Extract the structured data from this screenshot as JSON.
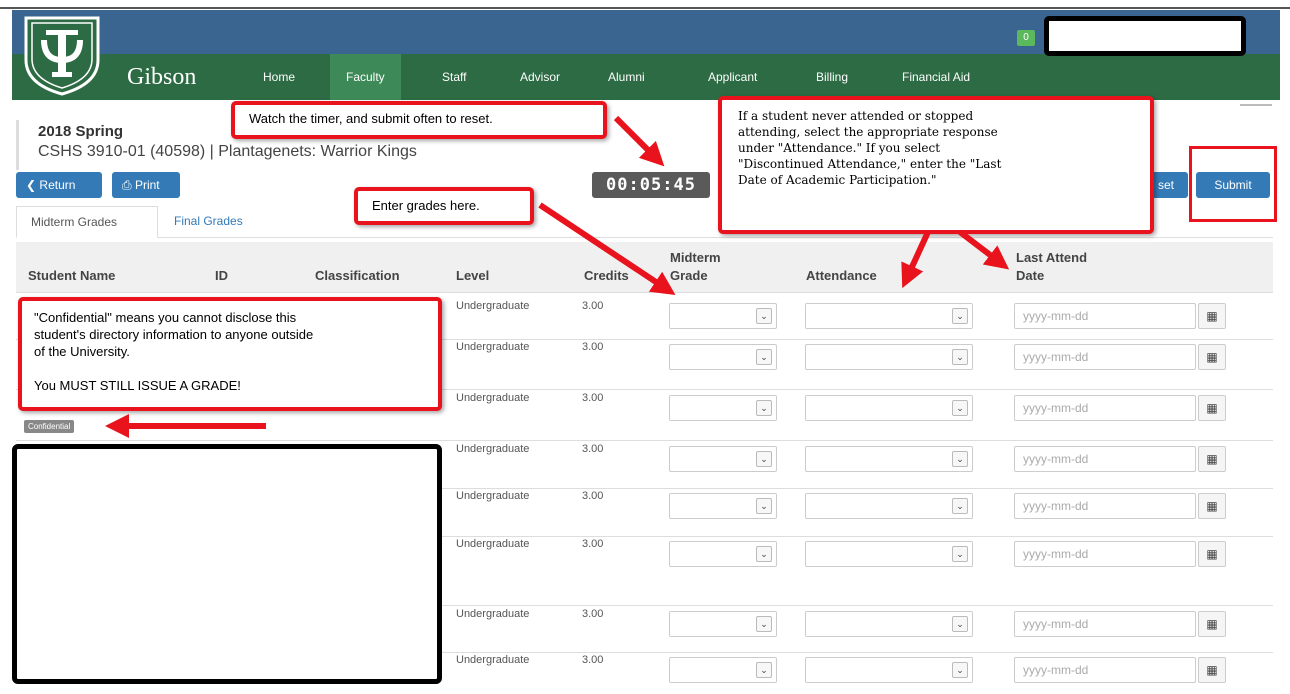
{
  "app": {
    "brand": "Gibson",
    "notification_count": "0"
  },
  "nav": [
    "Home",
    "Faculty",
    "Staff",
    "Advisor",
    "Alumni",
    "Applicant",
    "Billing",
    "Financial Aid"
  ],
  "header": {
    "term": "2018 Spring",
    "course": "CSHS 3910-01 (40598) | Plantagenets: Warrior Kings",
    "timer": "00:05:45"
  },
  "buttons": {
    "return": "Return",
    "print": "Print",
    "reset": "set",
    "submit": "Submit"
  },
  "tabs": [
    "Midterm Grades",
    "Final Grades"
  ],
  "table": {
    "headers": {
      "student_name": "Student Name",
      "id": "ID",
      "classification": "Classification",
      "level": "Level",
      "credits": "Credits",
      "midterm_grade_1": "Midterm",
      "midterm_grade_2": "Grade",
      "attendance": "Attendance",
      "last_attend_1": "Last Attend",
      "last_attend_2": "Date"
    },
    "rows": [
      {
        "level": "Undergraduate",
        "credits": "3.00",
        "date_placeholder": "yyyy-mm-dd"
      },
      {
        "level": "Undergraduate",
        "credits": "3.00",
        "date_placeholder": "yyyy-mm-dd"
      },
      {
        "level": "Undergraduate",
        "credits": "3.00",
        "date_placeholder": "yyyy-mm-dd"
      },
      {
        "level": "Undergraduate",
        "credits": "3.00",
        "date_placeholder": "yyyy-mm-dd"
      },
      {
        "level": "Undergraduate",
        "credits": "3.00",
        "date_placeholder": "yyyy-mm-dd"
      },
      {
        "level": "Undergraduate",
        "credits": "3.00",
        "date_placeholder": "yyyy-mm-dd"
      },
      {
        "level": "Undergraduate",
        "credits": "3.00",
        "date_placeholder": "yyyy-mm-dd"
      },
      {
        "level": "Undergraduate",
        "credits": "3.00",
        "date_placeholder": "yyyy-mm-dd"
      }
    ],
    "confidential_badge": "Confidential"
  },
  "annotations": {
    "timer_note": "Watch the timer, and submit often to reset.",
    "grades_note": "Enter grades here.",
    "attendance_note_1": "If a student never attended or stopped",
    "attendance_note_2": "attending, select the appropriate response",
    "attendance_note_3": "under \"Attendance.\"  If you select",
    "attendance_note_4": "\"Discontinued Attendance,\" enter the \"Last",
    "attendance_note_5": "Date of Academic Participation.\"",
    "confidential_note_1": "\"Confidential\" means you cannot disclose this",
    "confidential_note_2": "student's directory information to anyone outside",
    "confidential_note_3": "of the University.",
    "confidential_note_4": "You MUST STILL ISSUE A GRADE!"
  },
  "colors": {
    "top_bar": "#3a6591",
    "nav_bar": "#2c6b43",
    "primary": "#337ab7",
    "annotation_red": "#e8131c"
  }
}
